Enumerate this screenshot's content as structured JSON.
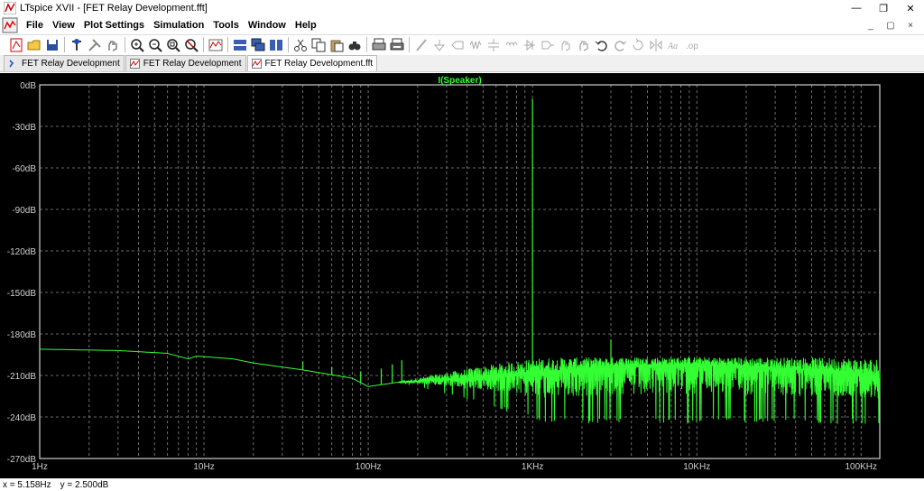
{
  "window": {
    "title": "LTspice XVII - [FET Relay Development.fft]",
    "controls": {
      "minimize": "—",
      "maximize": "❐",
      "close": "✕"
    }
  },
  "menu": {
    "items": [
      "File",
      "View",
      "Plot Settings",
      "Simulation",
      "Tools",
      "Window",
      "Help"
    ],
    "mdi": {
      "minimize": "_",
      "restore": "▢",
      "close": "×"
    }
  },
  "toolbar": {
    "icons": [
      "new-schematic-icon",
      "open-icon",
      "save-icon",
      "separator",
      "control-panel-icon",
      "run-icon",
      "pan-icon",
      "separator",
      "zoom-in-icon",
      "zoom-out-icon",
      "zoom-area-icon",
      "zoom-cancel-icon",
      "separator",
      "autorange-icon",
      "separator",
      "tile-horizontal-icon",
      "cascade-icon",
      "tile-vertical-icon",
      "separator",
      "cut-icon",
      "copy-icon",
      "paste-icon",
      "find-icon",
      "separator",
      "print-icon",
      "print-setup-icon",
      "separator",
      "draw-wire-icon",
      "ground-icon",
      "label-net-icon",
      "resistor-icon",
      "capacitor-icon",
      "inductor-icon",
      "diode-icon",
      "component-icon",
      "move-icon",
      "drag-icon",
      "undo-icon",
      "redo-icon",
      "rotate-icon",
      "mirror-icon",
      "text-icon",
      "spice-directive-icon"
    ]
  },
  "tabs": [
    {
      "label": "FET Relay Development",
      "active": false,
      "icon": "schematic-icon"
    },
    {
      "label": "FET Relay Development",
      "active": false,
      "icon": "waveform-icon"
    },
    {
      "label": "FET Relay Development.fft",
      "active": true,
      "icon": "waveform-icon"
    }
  ],
  "plot": {
    "trace_name": "I(Speaker)",
    "trace_color": "#33ff33",
    "background": "#000000",
    "grid_color": "#8a8a8a",
    "y_ticks": [
      "0dB",
      "-30dB",
      "-60dB",
      "-90dB",
      "-120dB",
      "-150dB",
      "-180dB",
      "-210dB",
      "-240dB",
      "-270dB"
    ],
    "x_ticks": [
      "1Hz",
      "10Hz",
      "100Hz",
      "1KHz",
      "10KHz",
      "100KHz"
    ]
  },
  "chart_data": {
    "type": "line",
    "title": "I(Speaker)",
    "xscale": "log",
    "xlim": [
      1,
      130000
    ],
    "ylim": [
      -270,
      0
    ],
    "x_ticks": [
      "1Hz",
      "10Hz",
      "100Hz",
      "1KHz",
      "10KHz",
      "100KHz"
    ],
    "y_ticks": [
      "0dB",
      "-30dB",
      "-60dB",
      "-90dB",
      "-120dB",
      "-150dB",
      "-180dB",
      "-210dB",
      "-240dB",
      "-270dB"
    ],
    "grid": true,
    "series": [
      {
        "name": "I(Speaker)",
        "color": "#33ff33",
        "baseline": [
          [
            1,
            -191
          ],
          [
            3,
            -192
          ],
          [
            6,
            -194
          ],
          [
            8,
            -198
          ],
          [
            9,
            -196
          ],
          [
            15,
            -198
          ],
          [
            20,
            -201
          ],
          [
            40,
            -206
          ],
          [
            80,
            -212
          ],
          [
            100,
            -218
          ],
          [
            150,
            -215
          ],
          [
            200,
            -214
          ],
          [
            400,
            -212
          ],
          [
            1000,
            -208
          ],
          [
            3000,
            -203
          ],
          [
            10000,
            -202
          ],
          [
            40000,
            -205
          ],
          [
            80000,
            -207
          ],
          [
            130000,
            -212
          ]
        ],
        "peaks": [
          [
            1000,
            -10
          ],
          [
            3000,
            -184
          ],
          [
            40,
            -200
          ],
          [
            60,
            -204
          ],
          [
            90,
            -207
          ],
          [
            120,
            -205
          ],
          [
            140,
            -202
          ],
          [
            160,
            -199
          ]
        ],
        "noise_band": {
          "from_hz": 150,
          "to_hz": 130000,
          "low": -245,
          "high": -196
        }
      }
    ]
  },
  "status": {
    "x_readout": "x = 5.158Hz",
    "y_readout": "y = 2.500dB"
  }
}
